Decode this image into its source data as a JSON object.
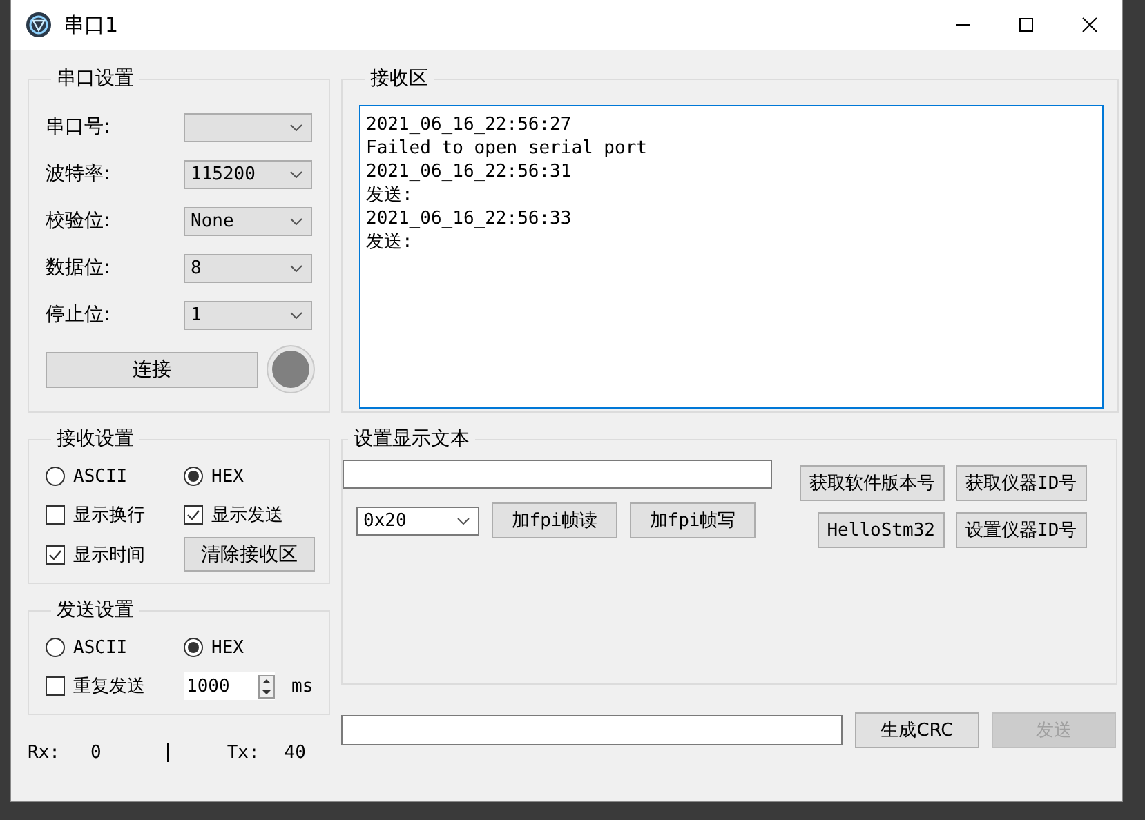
{
  "window": {
    "title": "串口1"
  },
  "serial_settings": {
    "title": "串口设置",
    "fields": [
      {
        "label": "串口号:"
      },
      {
        "label": "波特率:",
        "value": "115200"
      },
      {
        "label": "校验位:",
        "value": "None"
      },
      {
        "label": "数据位:",
        "value": "8"
      },
      {
        "label": "停止位:",
        "value": "1"
      }
    ],
    "connect_button": "连接",
    "connected": false
  },
  "receive_area": {
    "title": "接收区",
    "lines": [
      "2021_06_16_22:56:27",
      "Failed to open serial port",
      "2021_06_16_22:56:31",
      "发送:",
      "2021_06_16_22:56:33",
      "发送:"
    ]
  },
  "receive_settings": {
    "title": "接收设置",
    "format_options": [
      {
        "label": "ASCII",
        "selected": false
      },
      {
        "label": "HEX",
        "selected": true
      }
    ],
    "checkboxes": [
      {
        "label": "显示换行",
        "checked": false
      },
      {
        "label": "显示发送",
        "checked": true
      },
      {
        "label": "显示时间",
        "checked": true
      }
    ],
    "clear_button": "清除接收区"
  },
  "send_settings": {
    "title": "发送设置",
    "format_options": [
      {
        "label": "ASCII",
        "selected": false
      },
      {
        "label": "HEX",
        "selected": true
      }
    ],
    "repeat": {
      "label": "重复发送",
      "checked": false,
      "interval": "1000",
      "unit": "ms"
    }
  },
  "display_text": {
    "title": "设置显示文本",
    "combo": "0x20",
    "frame_buttons": [
      "加fpi帧读",
      "加fpi帧写"
    ],
    "command_buttons": [
      "获取软件版本号",
      "获取仪器ID号",
      "HelloStm32",
      "设置仪器ID号"
    ]
  },
  "send_row": {
    "crc_button": "生成CRC",
    "send_button": {
      "label": "发送",
      "disabled": true
    }
  },
  "status_bar": {
    "rx_label": "Rx:",
    "rx": "0",
    "tx_label": "Tx:",
    "tx": "40"
  }
}
